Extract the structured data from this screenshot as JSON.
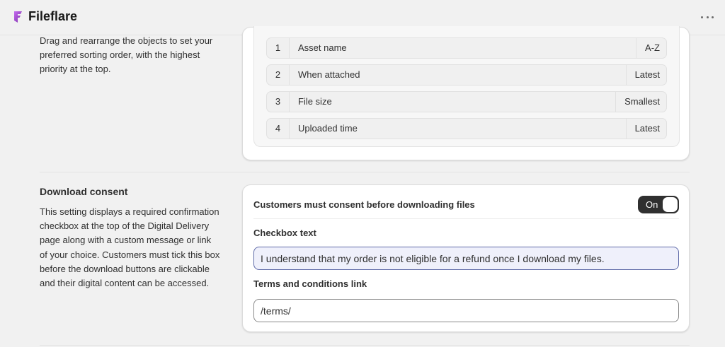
{
  "header": {
    "app_name": "Fileflare",
    "logo_icon": "fileflare-logo-icon",
    "more_icon": "more-horizontal-icon",
    "brand_color": "#8e44ad"
  },
  "sorting": {
    "description": "Drag and rearrange the objects to set your preferred sorting order, with the highest priority at the top.",
    "items": [
      {
        "position": "1",
        "label": "Asset name",
        "order": "A-Z"
      },
      {
        "position": "2",
        "label": "When attached",
        "order": "Latest"
      },
      {
        "position": "3",
        "label": "File size",
        "order": "Smallest"
      },
      {
        "position": "4",
        "label": "Uploaded time",
        "order": "Latest"
      }
    ]
  },
  "download_consent": {
    "title": "Download consent",
    "description": "This setting displays a required confirmation checkbox at the top of the Digital Delivery page along with a custom message or link of your choice. Customers must tick this box before the download buttons are clickable and their digital content can be accessed.",
    "consent_label": "Customers must consent before downloading files",
    "toggle_label": "On",
    "checkbox_text_label": "Checkbox text",
    "checkbox_text_value": "I understand that my order is not eligible for a refund once I download my files.",
    "terms_label": "Terms and conditions link",
    "terms_value": "/terms/"
  }
}
